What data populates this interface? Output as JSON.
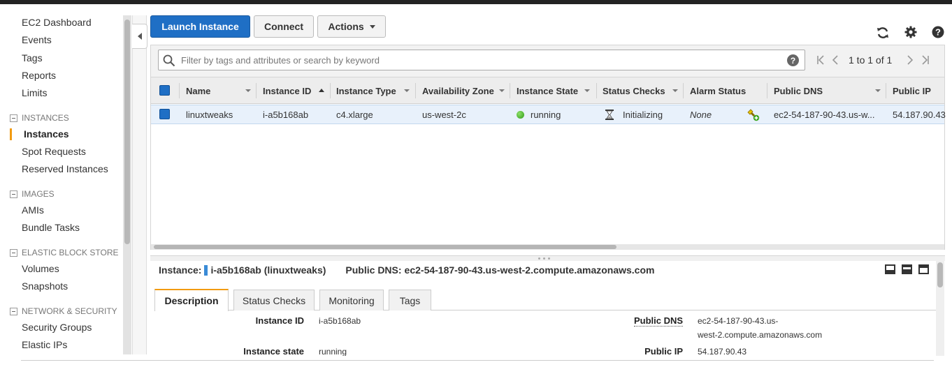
{
  "sidebar": {
    "top_links": [
      "EC2 Dashboard",
      "Events",
      "Tags",
      "Reports",
      "Limits"
    ],
    "sections": [
      {
        "title": "INSTANCES",
        "items": [
          "Instances",
          "Spot Requests",
          "Reserved Instances"
        ],
        "active": "Instances"
      },
      {
        "title": "IMAGES",
        "items": [
          "AMIs",
          "Bundle Tasks"
        ]
      },
      {
        "title": "ELASTIC BLOCK STORE",
        "items": [
          "Volumes",
          "Snapshots"
        ]
      },
      {
        "title": "NETWORK & SECURITY",
        "items": [
          "Security Groups",
          "Elastic IPs"
        ]
      }
    ]
  },
  "toolbar": {
    "launch_label": "Launch Instance",
    "connect_label": "Connect",
    "actions_label": "Actions",
    "icons": [
      "refresh-icon",
      "gear-icon",
      "help-icon"
    ]
  },
  "search": {
    "placeholder": "Filter by tags and attributes or search by keyword",
    "help": "?"
  },
  "pagination": {
    "text": "1 to 1 of 1"
  },
  "table": {
    "columns": [
      "Name",
      "Instance ID",
      "Instance Type",
      "Availability Zone",
      "Instance State",
      "Status Checks",
      "Alarm Status",
      "Public DNS",
      "Public IP"
    ],
    "sorted_column": "Instance ID",
    "rows": [
      {
        "name": "linuxtweaks",
        "instance_id": "i-a5b168ab",
        "instance_type": "c4.xlarge",
        "availability_zone": "us-west-2c",
        "instance_state": "running",
        "status_checks": "Initializing",
        "alarm_status": "None",
        "public_dns": "ec2-54-187-90-43.us-w...",
        "public_ip": "54.187.90.43"
      }
    ]
  },
  "detail": {
    "instance_label": "Instance:",
    "instance_value": "i-a5b168ab (linuxtweaks)",
    "dns_label": "Public DNS:",
    "dns_value": "ec2-54-187-90-43.us-west-2.compute.amazonaws.com",
    "tabs": [
      "Description",
      "Status Checks",
      "Monitoring",
      "Tags"
    ],
    "active_tab": "Description",
    "fields": {
      "instance_id_label": "Instance ID",
      "instance_id_value": "i-a5b168ab",
      "instance_state_label": "Instance state",
      "instance_state_value": "running",
      "public_dns_label": "Public DNS",
      "public_dns_value_line1": "ec2-54-187-90-43.us-",
      "public_dns_value_line2": "west-2.compute.amazonaws.com",
      "public_ip_label": "Public IP",
      "public_ip_value": "54.187.90.43"
    }
  },
  "colors": {
    "primary": "#1f6fc5",
    "active_accent": "#f29b11",
    "running": "#2e9b16",
    "selected_row": "#e8f1fb"
  }
}
